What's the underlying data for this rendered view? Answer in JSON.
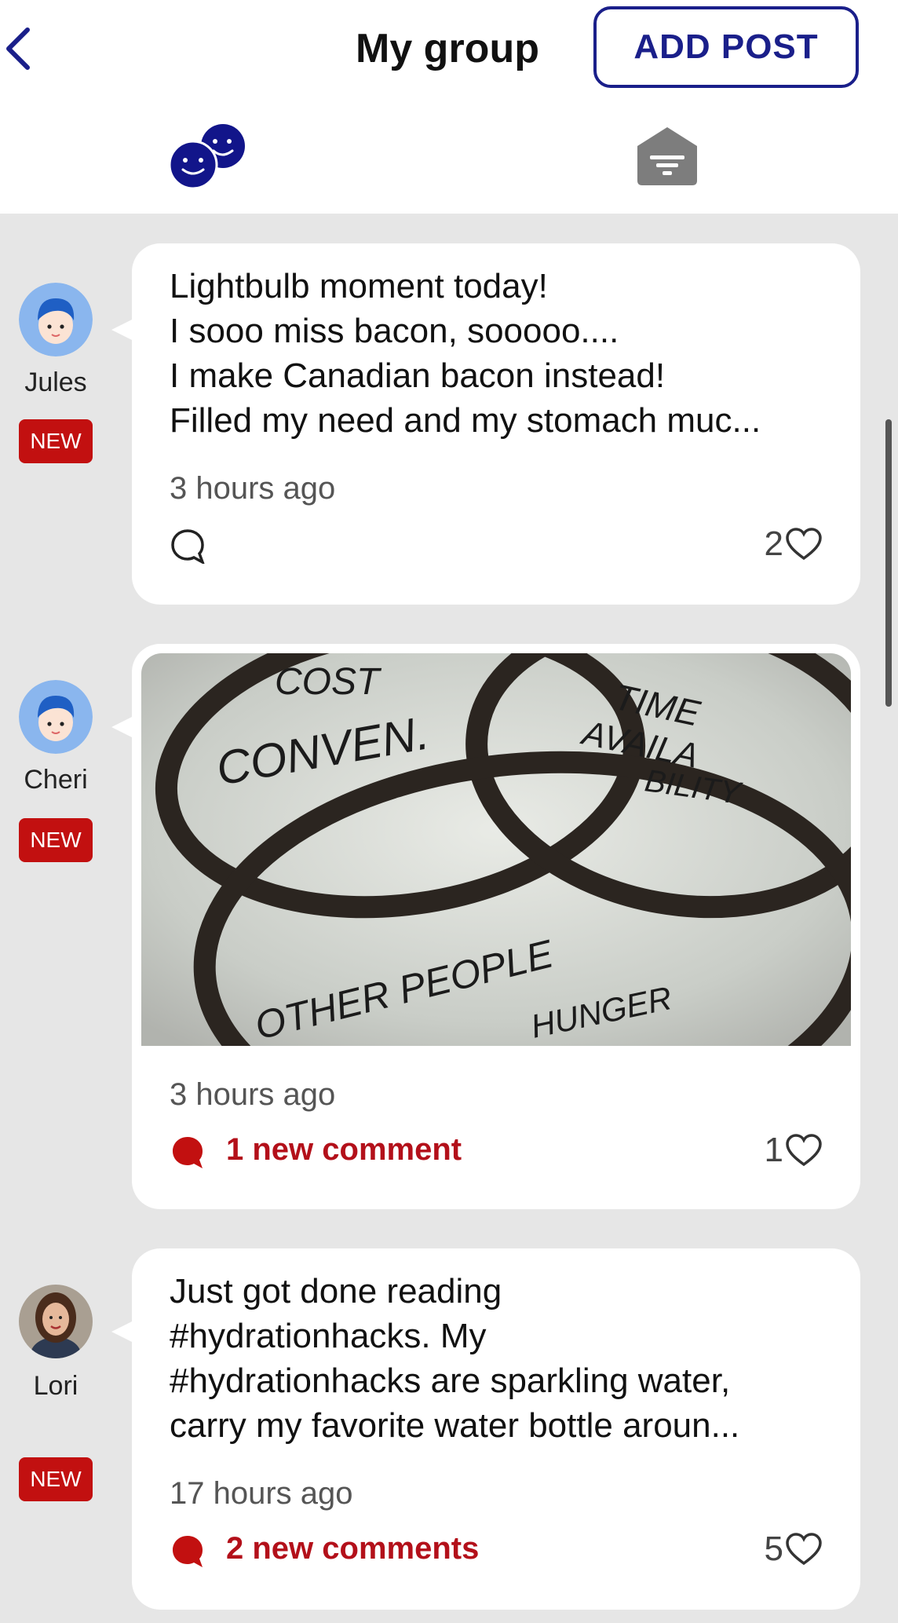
{
  "header": {
    "title": "My group",
    "add_post_label": "ADD POST",
    "back_icon": "chevron-left-icon",
    "tabs": [
      {
        "icon": "group-faces-icon",
        "active": true
      },
      {
        "icon": "inbox-envelope-icon",
        "active": false
      }
    ]
  },
  "colors": {
    "brand": "#1a1f8a",
    "alert": "#c21010",
    "background": "#e6e6e6"
  },
  "posts": [
    {
      "author": "Jules",
      "badge": "NEW",
      "text": "Lightbulb moment today!\nI sooo miss bacon, sooooo....\nI make Canadian bacon instead!\nFilled my need and my stomach muc...",
      "time": "3 hours ago",
      "comments_label": "",
      "likes": "2",
      "avatar": "boy-avatar-icon"
    },
    {
      "author": "Cheri",
      "badge": "NEW",
      "image_words": [
        "COST",
        "CONVEN.",
        "TIME",
        "AVAILA",
        "BILITY",
        "OTHER PEOPLE",
        "HUNGER"
      ],
      "time": "3 hours ago",
      "comments_label": "1 new comment",
      "likes": "1",
      "avatar": "boy-avatar-icon"
    },
    {
      "author": "Lori",
      "badge": "NEW",
      "text": "Just got done reading\n#hydrationhacks.  My\n#hydrationhacks are sparkling water,\ncarry my favorite water bottle aroun...",
      "time": "17 hours ago",
      "comments_label": "2 new comments",
      "likes": "5",
      "avatar": "woman-photo-avatar"
    }
  ]
}
